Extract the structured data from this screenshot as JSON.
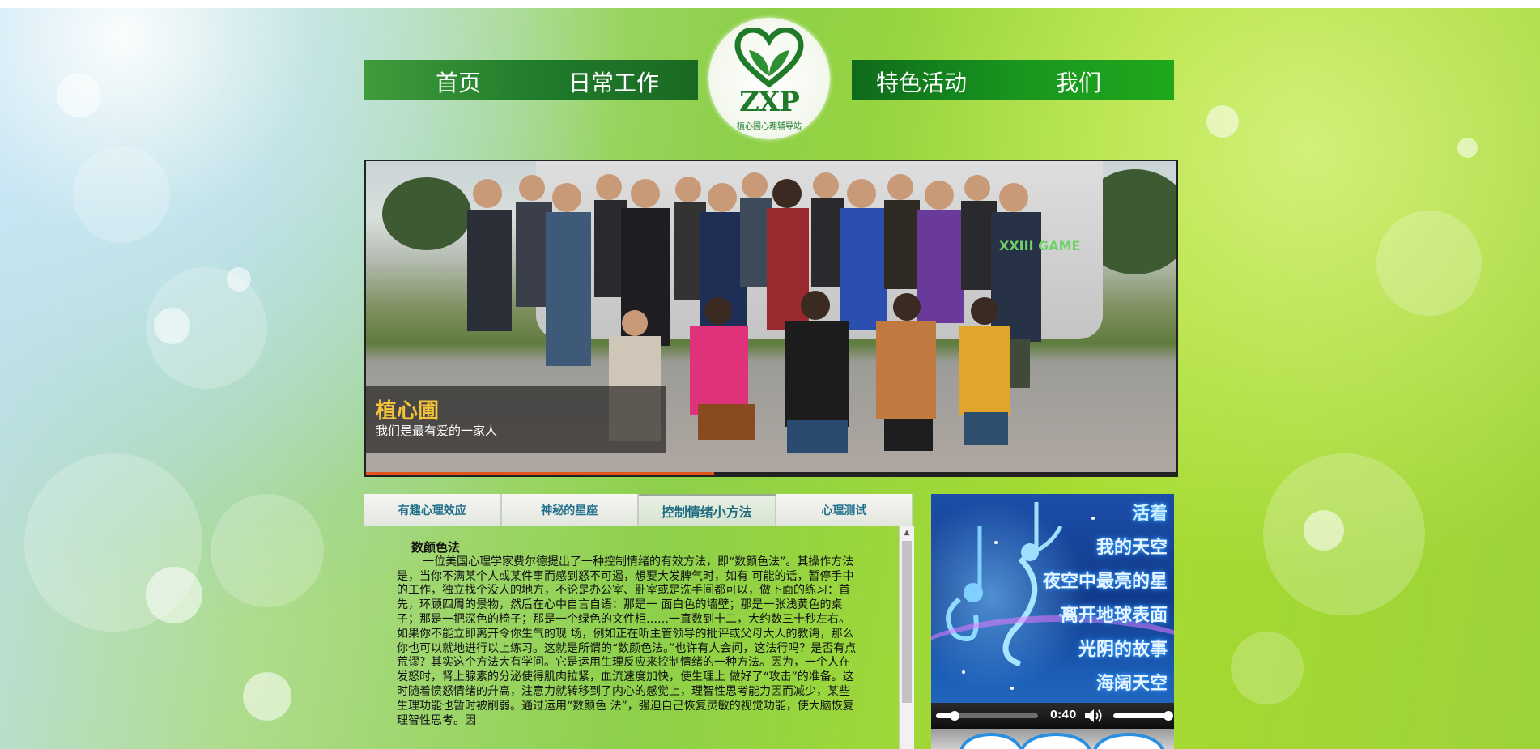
{
  "nav": {
    "items_left": [
      "首页",
      "日常工作"
    ],
    "items_right": [
      "特色活动",
      "我们"
    ]
  },
  "logo": {
    "text": "ZXP",
    "subtitle": "植心圃心理辅导站",
    "color": "#1f7a2a"
  },
  "banner": {
    "title": "植心圃",
    "subtitle": "我们是最有爱的一家人",
    "progress": 0.43,
    "jersey_text": "XXIII GAME"
  },
  "tabs": [
    {
      "label": "有趣心理效应",
      "active": false
    },
    {
      "label": "神秘的星座",
      "active": false
    },
    {
      "label": "控制情绪小方法",
      "active": true
    },
    {
      "label": "心理测试",
      "active": false
    }
  ],
  "content": {
    "title": "数颜色法",
    "body": "一位美国心理学家费尔德提出了一种控制情绪的有效方法，即“数颜色法”。其操作方法是，当你不满某个人或某件事而感到怒不可遏，想要大发脾气时，如有 可能的话，暂停手中的工作，独立找个没人的地方，不论是办公室、卧室或是洗手间都可以，做下面的练习：首先，环顾四周的景物，然后在心中自言自语：那是一 面白色的墙壁；那是一张浅黄色的桌子；那是一把深色的椅子；那是一个绿色的文件柜……一直数到十二，大约数三十秒左右。如果你不能立即离开令你生气的现 场，例如正在听主管领导的批评或父母大人的教诲，那么你也可以就地进行以上练习。这就是所谓的“数颜色法。”也许有人会问，这法行吗？是否有点荒谬？其实这个方法大有学问。它是运用生理反应来控制情绪的一种方法。因为，一个人在发怒时，肾上腺素的分泌使得肌肉拉紧，血流速度加快，使生理上 做好了“攻击”的准备。这时随着愤怒情绪的升高，注意力就转移到了内心的感觉上，理智性思考能力因而减少，某些生理功能也暂时被削弱。通过运用“数颜色 法”，强迫自己恢复灵敏的视觉功能，使大脑恢复理智性思考。因"
  },
  "music": {
    "titles": [
      "活着",
      "我的天空",
      "夜空中最亮的星",
      "离开地球表面",
      "光阴的故事",
      "海阔天空"
    ],
    "time": "0:40",
    "progress": 0.18,
    "volume": 1.0,
    "volume_icon": "speaker-icon"
  }
}
